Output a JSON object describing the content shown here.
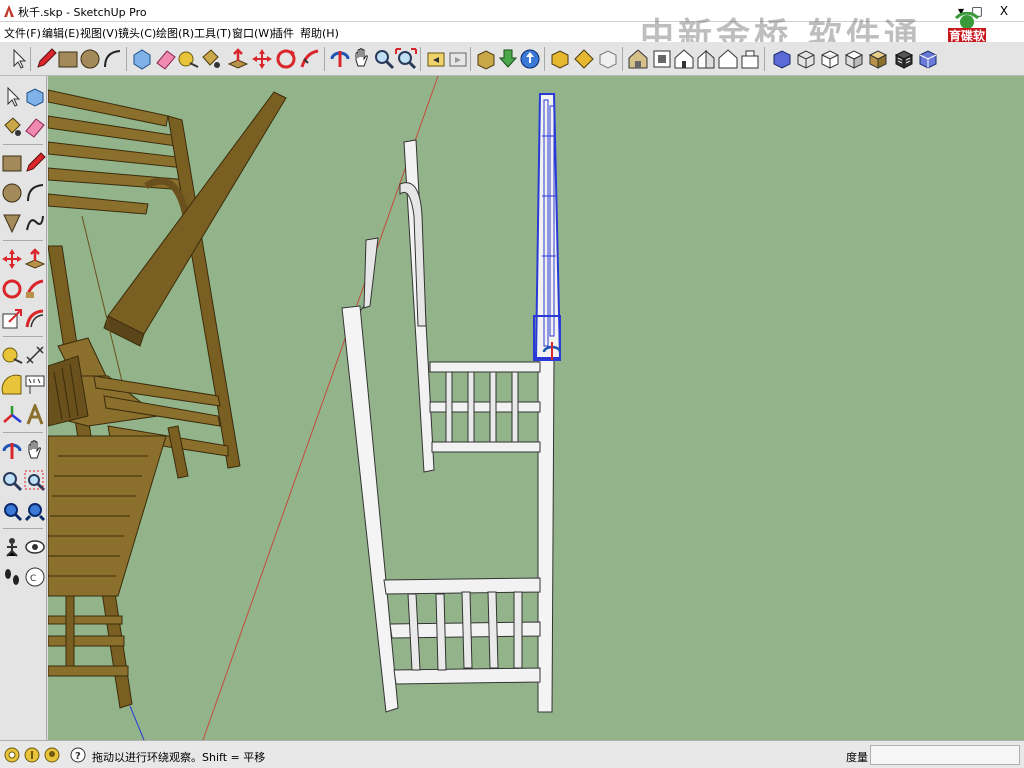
{
  "window": {
    "title": "秋千.skp - SketchUp Pro",
    "minimize": "▾",
    "maximize": "□",
    "close": "X"
  },
  "menu": [
    "文件(F)",
    "编辑(E)",
    "视图(V)",
    "镜头(C)",
    "绘图(R)",
    "工具(T)",
    "窗口(W)",
    "插件",
    "帮助(H)"
  ],
  "watermark": {
    "text": "中新金桥 软件通",
    "logo_text": "育碟软件"
  },
  "toolbar_icons": [
    "select-icon",
    "pencil-icon",
    "rectangle-icon",
    "circle-icon",
    "arc-icon",
    "make-component-icon",
    "eraser-icon",
    "tape-measure-icon",
    "paint-bucket-icon",
    "push-pull-icon",
    "move-icon",
    "rotate-icon",
    "follow-me-icon",
    "orbit-icon",
    "pan-icon",
    "zoom-icon",
    "zoom-extents-icon",
    "previous-view-icon",
    "next-view-icon",
    "3d-warehouse-icon",
    "get-models-icon",
    "share-model-icon",
    "component-icon",
    "extension-icon",
    "iso-view-icon",
    "top-view-icon",
    "front-view-icon",
    "right-view-icon",
    "back-view-icon",
    "left-view-icon",
    "xray-icon",
    "wireframe-icon",
    "hidden-line-icon",
    "shaded-icon",
    "shaded-textures-icon",
    "monochrome-icon"
  ],
  "status": {
    "hint": "拖动以进行环绕观察。Shift = 平移",
    "measure_label": "度量",
    "measure_value": ""
  },
  "colors": {
    "viewport": "#93b48a",
    "wood": "#8b6f2c",
    "wood_dark": "#5a451a",
    "white_model": "#f2f2f2",
    "selection": "#2a3ad6"
  }
}
